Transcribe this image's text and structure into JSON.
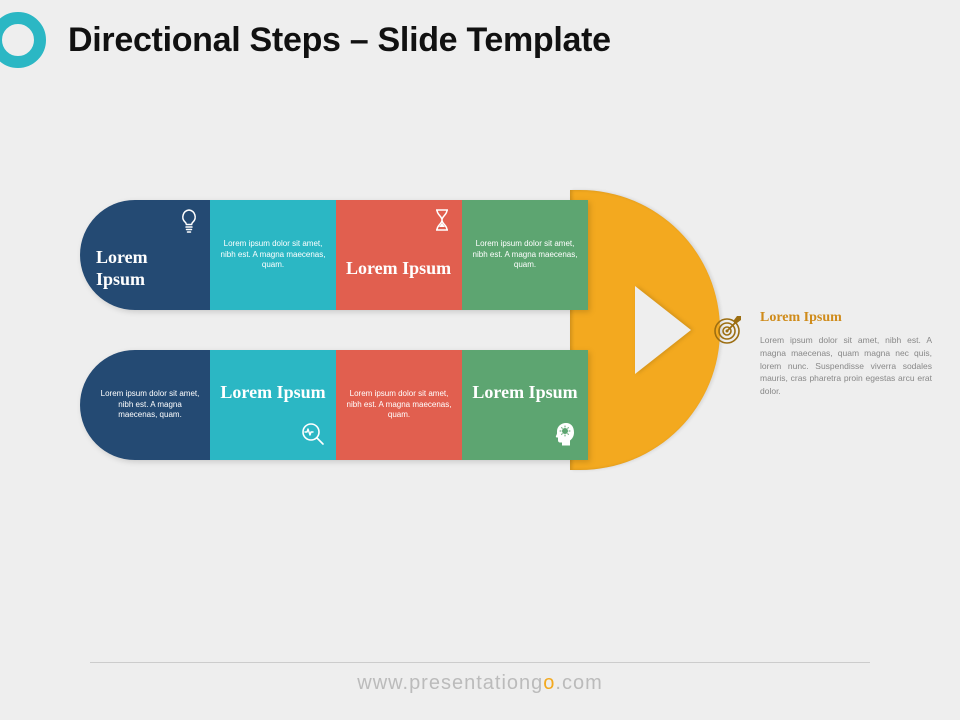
{
  "header": {
    "title": "Directional Steps – Slide Template"
  },
  "top_row": {
    "s1": {
      "title": "Lorem Ipsum"
    },
    "s2": {
      "body": "Lorem ipsum dolor sit amet, nibh est. A magna maecenas, quam."
    },
    "s3": {
      "title": "Lorem Ipsum"
    },
    "s4": {
      "body": "Lorem ipsum dolor sit amet, nibh est. A magna maecenas, quam."
    }
  },
  "bot_row": {
    "s1": {
      "body": "Lorem ipsum dolor sit amet, nibh est. A magna maecenas, quam."
    },
    "s2": {
      "title": "Lorem Ipsum"
    },
    "s3": {
      "body": "Lorem ipsum dolor sit amet, nibh est. A magna maecenas, quam."
    },
    "s4": {
      "title": "Lorem Ipsum"
    }
  },
  "result": {
    "title": "Lorem Ipsum",
    "body": "Lorem ipsum dolor sit amet, nibh est. A magna maecenas, quam magna nec quis, lorem nunc. Suspendisse viverra sodales mauris, cras pharetra proin egestas arcu erat dolor."
  },
  "footer": {
    "pre": "www.",
    "mid": "presentationg",
    "o": "o",
    "post": ".com"
  }
}
